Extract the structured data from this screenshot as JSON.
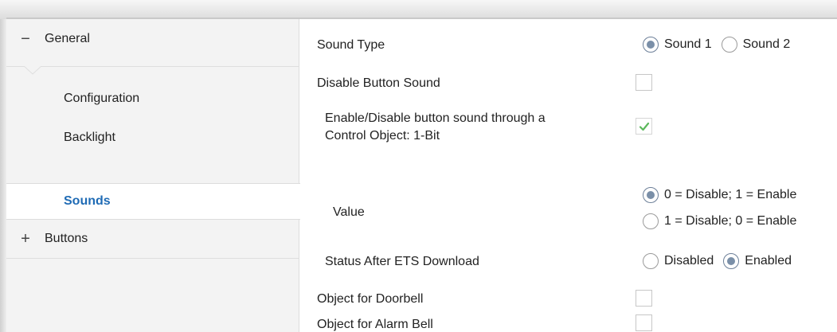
{
  "sidebar": {
    "groups": [
      {
        "label": "General",
        "expander": "−",
        "expanded": true,
        "items": [
          {
            "label": "Configuration",
            "selected": false
          },
          {
            "label": "Backlight",
            "selected": false
          },
          {
            "label": "Sounds",
            "selected": true
          }
        ]
      },
      {
        "label": "Buttons",
        "expander": "+",
        "expanded": false,
        "items": []
      }
    ]
  },
  "main": {
    "sound_type": {
      "label": "Sound Type",
      "options": [
        {
          "label": "Sound 1",
          "selected": true
        },
        {
          "label": "Sound 2",
          "selected": false
        }
      ]
    },
    "disable_button_sound": {
      "label": "Disable Button Sound",
      "checked": false
    },
    "enable_disable_object": {
      "label_line1": "Enable/Disable button sound through a",
      "label_line2": "Control Object: 1-Bit",
      "checked": true
    },
    "value": {
      "label": "Value",
      "options": [
        {
          "label": "0 = Disable; 1 = Enable",
          "selected": true
        },
        {
          "label": "1 = Disable; 0 = Enable",
          "selected": false
        }
      ]
    },
    "status_after_download": {
      "label": "Status After ETS Download",
      "options": [
        {
          "label": "Disabled",
          "selected": false
        },
        {
          "label": "Enabled",
          "selected": true
        }
      ]
    },
    "object_doorbell": {
      "label": "Object for Doorbell",
      "checked": false
    },
    "object_alarm_bell": {
      "label": "Object for Alarm Bell",
      "checked": false
    }
  },
  "colors": {
    "selected_nav_text": "#1f6bb5",
    "checkmark": "#5cb85c",
    "radio_dot": "#7a8fa8"
  }
}
